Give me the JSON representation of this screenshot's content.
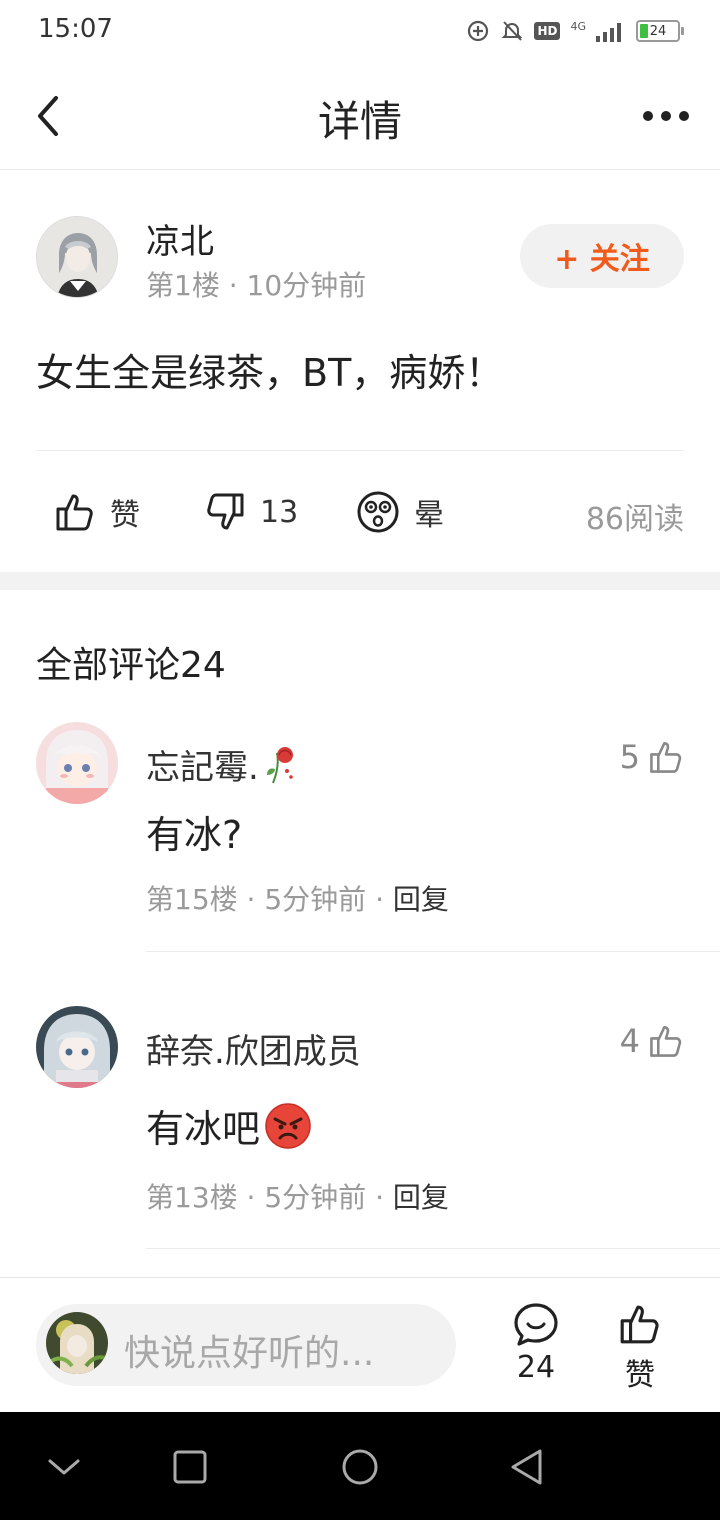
{
  "status_bar": {
    "time": "15:07",
    "hd": "HD",
    "network": "4G",
    "battery": "24"
  },
  "header": {
    "title": "详情"
  },
  "post": {
    "author": "凉北",
    "meta": "第1楼 · 10分钟前",
    "follow_label": "+ 关注",
    "body": "女生全是绿茶，BT，病娇！",
    "like_label": "赞",
    "dislike_count": "13",
    "dizzy_label": "晕",
    "reads": "86阅读"
  },
  "comments": {
    "header": "全部评论24",
    "items": [
      {
        "name": "忘記霉.",
        "text": "有冰?",
        "floor": "第15楼",
        "time": "5分钟前",
        "reply": "回复",
        "likes": "5"
      },
      {
        "name": "辞奈.欣团成员",
        "text": "有冰吧",
        "floor": "第13楼",
        "time": "5分钟前",
        "reply": "回复",
        "likes": "4"
      }
    ]
  },
  "bottom_bar": {
    "placeholder": "快说点好听的...",
    "comment_count": "24",
    "like_label": "赞"
  },
  "colors": {
    "accent": "#f05a1a",
    "muted": "#9a9a9a"
  }
}
